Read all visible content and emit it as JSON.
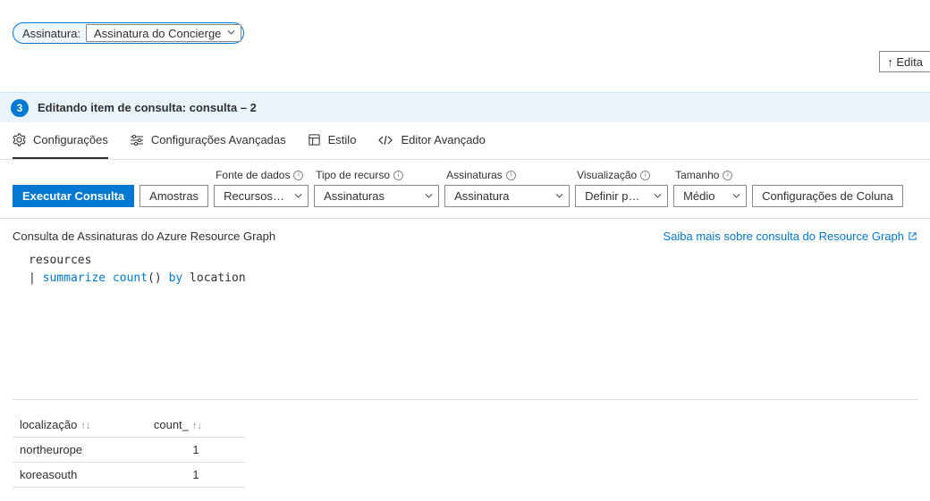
{
  "pill": {
    "label": "Assinatura:",
    "selected": "Assinatura do Concierge"
  },
  "topButton": "↑ Edita",
  "step": {
    "number": "3",
    "title": "Editando item de consulta: consulta – 2"
  },
  "tabs": {
    "settings": "Configurações",
    "advanced": "Configurações Avançadas",
    "style": "Estilo",
    "editor": "Editor Avançado"
  },
  "controls": {
    "run": "Executar Consulta",
    "samples": "Amostras",
    "dataSource": {
      "label": "Fonte de dados",
      "selected": "Recursos do..."
    },
    "resourceType": {
      "label": "Tipo de recurso",
      "selected": "Assinaturas"
    },
    "subscriptions": {
      "label": "Assinaturas",
      "selected": "Assinatura"
    },
    "visualization": {
      "label": "Visualização",
      "selected": "Definir por..."
    },
    "size": {
      "label": "Tamanho",
      "selected": "Médio"
    },
    "columns": "Configurações de Coluna"
  },
  "subheader": {
    "left": "Consulta de Assinaturas do Azure Resource Graph",
    "link": "Saiba mais sobre consulta do Resource Graph"
  },
  "query": {
    "line1": "resources",
    "pipe": "|",
    "kw1": "summarize",
    "func": "count",
    "paren": "()",
    "kw2": "by",
    "ident": "location"
  },
  "results": {
    "headers": {
      "location": "localização",
      "count": "count_"
    },
    "rows": [
      {
        "location": "northeurope",
        "count": "1"
      },
      {
        "location": "koreasouth",
        "count": "1"
      }
    ]
  },
  "chart_data": {
    "type": "table",
    "columns": [
      "localização",
      "count_"
    ],
    "rows": [
      [
        "northeurope",
        1
      ],
      [
        "koreasouth",
        1
      ]
    ]
  }
}
